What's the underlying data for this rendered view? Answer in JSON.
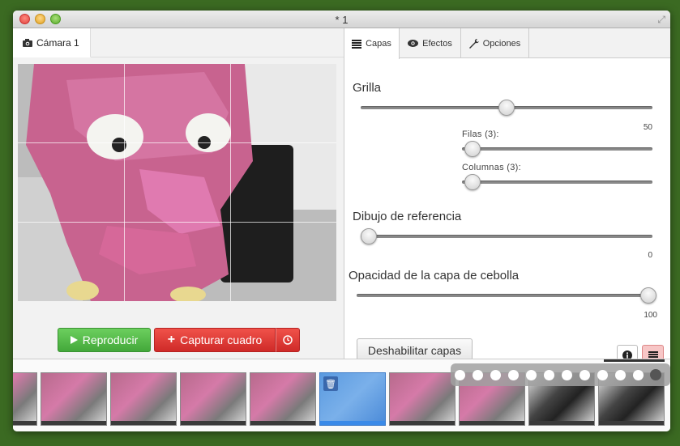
{
  "window": {
    "title": "* 1"
  },
  "camera": {
    "tab_label": "Cámara 1"
  },
  "controls": {
    "play_label": "Reproducir",
    "capture_label": "Capturar cuadro"
  },
  "tabs": [
    {
      "label": "Capas",
      "icon": "list-icon",
      "active": true
    },
    {
      "label": "Efectos",
      "icon": "eye-icon",
      "active": false
    },
    {
      "label": "Opciones",
      "icon": "wrench-icon",
      "active": false
    }
  ],
  "layers": {
    "grid": {
      "label": "Grilla",
      "value": "50",
      "level": 0.5,
      "rows_label": "Filas (3):",
      "rows_level": 0.0,
      "columns_label": "Columnas (3):",
      "columns_level": 0.0
    },
    "reference": {
      "label": "Dibujo de referencia",
      "value": "0",
      "level": 0.0
    },
    "onion": {
      "label": "Opacidad de la capa de cebolla",
      "value": "100",
      "level": 1.0
    },
    "disable_label": "Deshabilitar capas"
  },
  "filmstrip": {
    "frame_count": 10,
    "selected_index": 5
  },
  "colors": {
    "play": "#43a83a",
    "capture": "#cf2a28",
    "selected_frame": "#5a9ae0"
  }
}
